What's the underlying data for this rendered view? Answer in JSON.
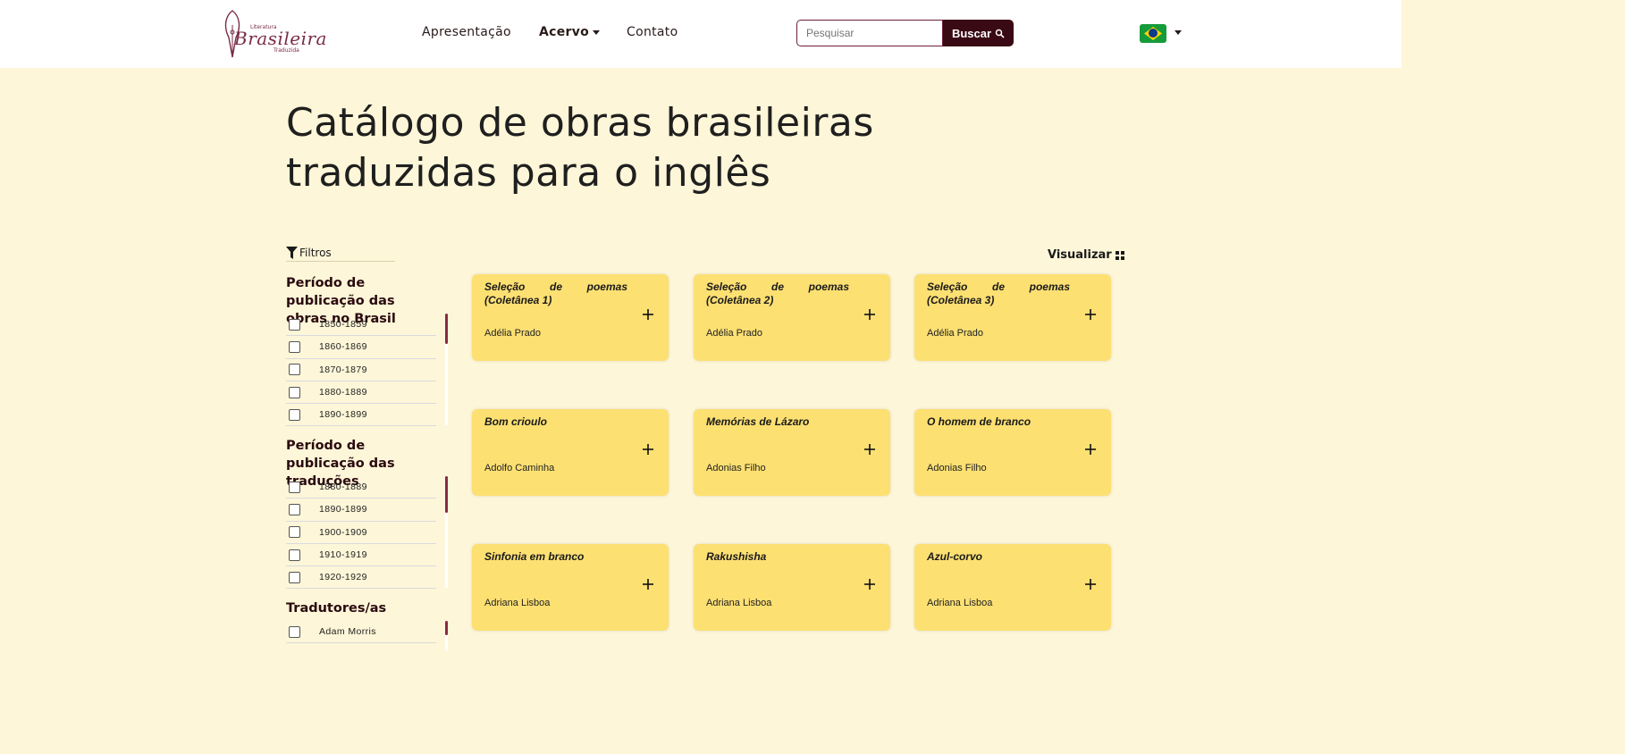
{
  "logo": {
    "small": "Literatura",
    "main": "Brasileira",
    "sub": "Traduzida"
  },
  "nav": {
    "items": [
      {
        "label": "Apresentação"
      },
      {
        "label": "Acervo"
      },
      {
        "label": "Contato"
      }
    ]
  },
  "search": {
    "placeholder": "Pesquisar",
    "button_label": "Buscar"
  },
  "page_title": "Catálogo de obras brasileiras traduzidas para o inglês",
  "filters": {
    "label": "Filtros",
    "groups": [
      {
        "title": "Período de publicação das obras no Brasil",
        "items": [
          "1850-1859",
          "1860-1869",
          "1870-1879",
          "1880-1889",
          "1890-1899"
        ]
      },
      {
        "title": "Período de publicação das traduções",
        "items": [
          "1880-1889",
          "1890-1899",
          "1900-1909",
          "1910-1919",
          "1920-1929"
        ]
      },
      {
        "title": "Tradutores/as",
        "items": [
          "Adam Morris"
        ]
      }
    ]
  },
  "view_label": "Visualizar",
  "cards": [
    {
      "title": "Seleção de poemas (Coletânea 1)",
      "author": "Adélia Prado"
    },
    {
      "title": "Seleção de poemas (Coletânea 2)",
      "author": "Adélia Prado"
    },
    {
      "title": "Seleção de poemas (Coletânea 3)",
      "author": "Adélia Prado"
    },
    {
      "title": "Bom crioulo",
      "author": "Adolfo Caminha"
    },
    {
      "title": "Memórias de Lázaro",
      "author": "Adonias Filho"
    },
    {
      "title": "O homem de branco",
      "author": "Adonias Filho"
    },
    {
      "title": "Sinfonia em branco",
      "author": "Adriana Lisboa"
    },
    {
      "title": "Rakushisha",
      "author": "Adriana Lisboa"
    },
    {
      "title": "Azul-corvo",
      "author": "Adriana Lisboa"
    }
  ],
  "colors": {
    "accent": "#3a0a14",
    "card": "#fde072",
    "background": "#fdf6d8",
    "brand": "#7a2d45"
  }
}
